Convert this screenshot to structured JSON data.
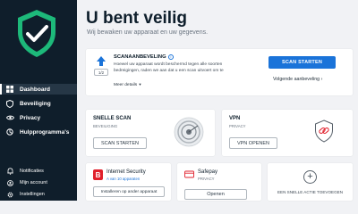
{
  "header": {
    "title": "U bent veilig",
    "subtitle": "Wij bewaken uw apparaat en uw gegevens."
  },
  "sidebar": {
    "main_items": [
      {
        "label": "Dashboard",
        "icon": "dashboard-icon",
        "active": true
      },
      {
        "label": "Beveiliging",
        "icon": "shield-icon"
      },
      {
        "label": "Privacy",
        "icon": "eye-icon"
      },
      {
        "label": "Hulpprogramma's",
        "icon": "tools-icon"
      }
    ],
    "bottom_items": [
      {
        "label": "Notificaties",
        "icon": "bell-icon"
      },
      {
        "label": "Mijn account",
        "icon": "account-icon"
      },
      {
        "label": "Instellingen",
        "icon": "settings-icon"
      }
    ]
  },
  "recommendation": {
    "heading": "SCANAANBEVELING",
    "text_line1": "Hoewel uw apparaat wordt beschermd tegen alle soorten",
    "text_line2": "bedreigingen, raden we aan dat u een scan uitvoert om te",
    "more": "Meer details",
    "counter": "1/2",
    "action_button": "SCAN STARTEN",
    "next_link": "Volgende aanbeveling"
  },
  "quick_scan": {
    "title": "SNELLE SCAN",
    "category": "BEVEILIGING",
    "button": "SCAN STARTEN"
  },
  "vpn": {
    "title": "VPN",
    "category": "PRIVACY",
    "button": "VPN OPENEN"
  },
  "internet_security": {
    "title": "Internet Security",
    "subtitle": "A van 10 apparaten",
    "button": "Installeren op ander apparaat"
  },
  "safepay": {
    "title": "Safepay",
    "category": "PRIVACY",
    "button": "Openen"
  },
  "add_action": {
    "label": "EEN SNELLE ACTIE TOEVOEGEN"
  },
  "colors": {
    "sidebar_bg": "#0f1e2b",
    "shield_green": "#1db97a",
    "accent_blue": "#1a73d9",
    "brand_red": "#e0202c"
  }
}
